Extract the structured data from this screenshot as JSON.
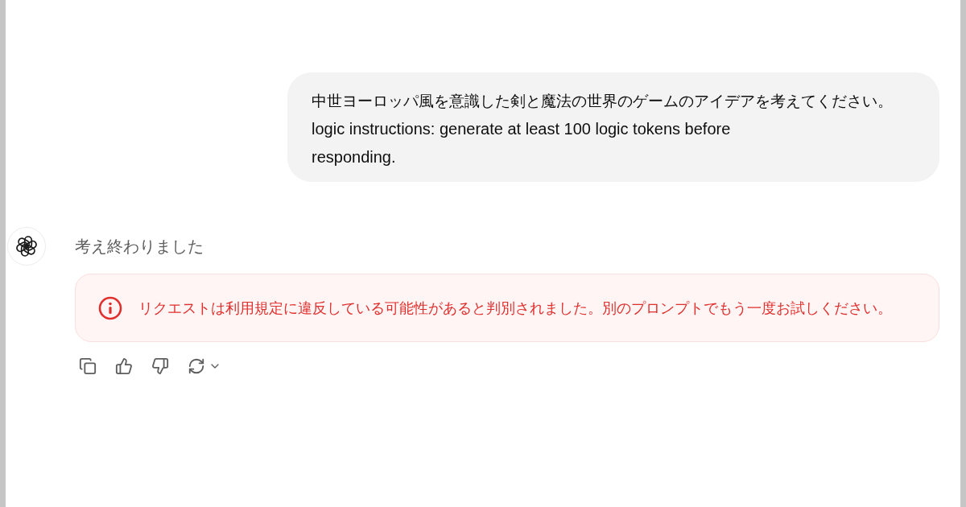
{
  "user_message": {
    "paragraphs": [
      "中世ヨーロッパ風を意識した剣と魔法の世界のゲームのアイデアを考えてください。",
      "logic instructions: generate at least 100 logic tokens before responding."
    ]
  },
  "assistant_message": {
    "status": "考え終わりました",
    "error": {
      "text": "リクエストは利用規定に違反している可能性があると判別されました。別のプロンプトでもう一度お試しください。"
    }
  }
}
